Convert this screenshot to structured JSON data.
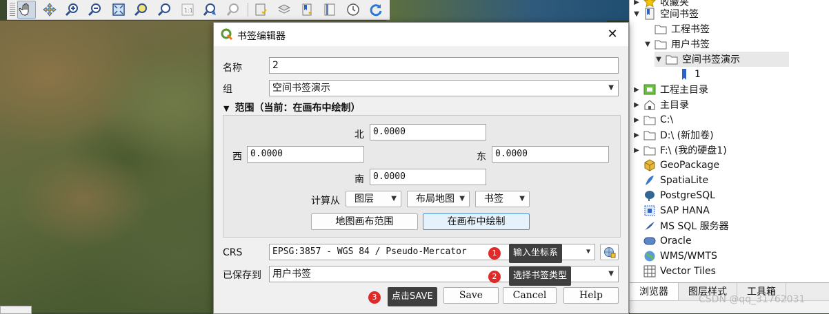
{
  "colors": {
    "accent": "#4a8fd6",
    "note_badge": "#e02a2a",
    "note_bg": "#3f3f3f"
  },
  "toolbar": {
    "icons": [
      "pan-hand-icon",
      "pan-to-selection-icon",
      "zoom-in-icon",
      "zoom-out-icon",
      "zoom-full-icon",
      "zoom-to-selection-icon",
      "zoom-to-layer-icon",
      "zoom-native-icon",
      "zoom-last-icon",
      "zoom-next-icon",
      "new-bookmark-icon",
      "show-bookmarks-icon",
      "new-map-view-icon",
      "new-3d-map-icon",
      "temporal-controller-icon",
      "refresh-icon"
    ]
  },
  "dialog": {
    "title": "书签编辑器",
    "close": "✕",
    "name_label": "名称",
    "name_value": "2",
    "group_label": "组",
    "group_value": "空间书签演示",
    "extent_header": "范围（当前：在画布中绘制）",
    "north_label": "北",
    "north_value": "0.0000",
    "west_label": "西",
    "west_value": "0.0000",
    "east_label": "东",
    "east_value": "0.0000",
    "south_label": "南",
    "south_value": "0.0000",
    "calc_from": "计算从",
    "btn_layer": "图层",
    "btn_layout_map": "布局地图",
    "btn_bookmark": "书签",
    "btn_map_canvas_extent": "地图画布范围",
    "btn_draw_on_canvas": "在画布中绘制",
    "crs_label": "CRS",
    "crs_value": "EPSG:3857 - WGS 84 / Pseudo-Mercator",
    "saved_to_label": "已保存到",
    "saved_to_value": "用户书签",
    "save": "Save",
    "cancel": "Cancel",
    "help": "Help"
  },
  "annotations": [
    {
      "num": "1",
      "text": "输入坐标系"
    },
    {
      "num": "2",
      "text": "选择书签类型"
    },
    {
      "num": "3",
      "text": "点击SAVE"
    }
  ],
  "browser": {
    "items": [
      {
        "label": "收藏夹",
        "icon": "star-icon"
      },
      {
        "label": "空间书签",
        "icon": "bookmark-folder-icon"
      },
      {
        "label": "工程书签",
        "icon": "folder-icon"
      },
      {
        "label": "用户书签",
        "icon": "folder-icon"
      },
      {
        "label": "空间书签演示",
        "icon": "folder-icon"
      },
      {
        "label": "1",
        "icon": "bookmark-icon"
      },
      {
        "label": "工程主目录",
        "icon": "project-home-icon"
      },
      {
        "label": "主目录",
        "icon": "home-icon"
      },
      {
        "label": "C:\\",
        "icon": "drive-icon"
      },
      {
        "label": "D:\\ (新加卷)",
        "icon": "drive-icon"
      },
      {
        "label": "F:\\ (我的硬盘1)",
        "icon": "drive-icon"
      },
      {
        "label": "GeoPackage",
        "icon": "geopackage-icon"
      },
      {
        "label": "SpatiaLite",
        "icon": "spatialite-icon"
      },
      {
        "label": "PostgreSQL",
        "icon": "postgresql-icon"
      },
      {
        "label": "SAP HANA",
        "icon": "sap-hana-icon"
      },
      {
        "label": "MS SQL 服务器",
        "icon": "mssql-icon"
      },
      {
        "label": "Oracle",
        "icon": "oracle-icon"
      },
      {
        "label": "WMS/WMTS",
        "icon": "wms-icon"
      },
      {
        "label": "Vector Tiles",
        "icon": "vector-tiles-icon"
      }
    ],
    "tabs": [
      "浏览器",
      "图层样式",
      "工具箱"
    ],
    "watermark": "CSDN @qq_31762031"
  }
}
